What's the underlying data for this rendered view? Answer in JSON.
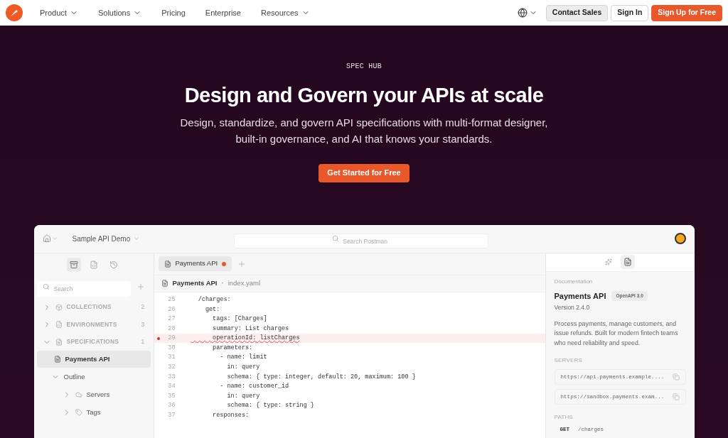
{
  "nav": {
    "items": [
      {
        "label": "Product",
        "dropdown": true
      },
      {
        "label": "Solutions",
        "dropdown": true
      },
      {
        "label": "Pricing",
        "dropdown": false
      },
      {
        "label": "Enterprise",
        "dropdown": false
      },
      {
        "label": "Resources",
        "dropdown": true
      }
    ],
    "buttons": [
      {
        "label": "Contact Sales",
        "kind": "secondary"
      },
      {
        "label": "Sign In",
        "kind": "outline"
      },
      {
        "label": "Sign Up for Free",
        "kind": "primary"
      }
    ]
  },
  "hero": {
    "eyebrow": "SPEC HUB",
    "title": "Design and Govern your APIs at scale",
    "subtitle": "Design, standardize, and govern API specifications with multi-format designer, built-in governance, and AI that knows your standards.",
    "cta": "Get Started for Free"
  },
  "app": {
    "workspace": "Sample API Demo",
    "search": {
      "placeholder": "Search Postman"
    },
    "sidebar": {
      "search": {
        "placeholder": "Search"
      },
      "sections": [
        {
          "label": "COLLECTIONS",
          "count": "2",
          "expanded": false
        },
        {
          "label": "ENVIRONMENTS",
          "count": "3",
          "expanded": false
        },
        {
          "label": "SPECIFICATIONS",
          "count": "1",
          "expanded": true
        }
      ],
      "items": [
        {
          "label": "Payments API",
          "selected": true,
          "children": [
            {
              "label": "Outline",
              "expanded": true,
              "children": [
                {
                  "label": "Servers",
                  "expanded": false
                },
                {
                  "label": "Tags",
                  "expanded": false
                }
              ]
            }
          ]
        }
      ]
    },
    "tabs": [
      {
        "label": "Payments API",
        "selected": true,
        "unsaved": true
      }
    ],
    "breadcrumb": {
      "title": "Payments API",
      "separator": "·",
      "file": "index.yaml"
    },
    "code": [
      {
        "line": "25",
        "text": "  /charges:",
        "error": false
      },
      {
        "line": "26",
        "text": "    get:",
        "error": false
      },
      {
        "line": "27",
        "text": "      tags: [Charges]",
        "error": false
      },
      {
        "line": "28",
        "text": "      summary: List charges",
        "error": false
      },
      {
        "line": "29",
        "text": "      operationId: listCharges",
        "error": true
      },
      {
        "line": "30",
        "text": "      parameters:",
        "error": false
      },
      {
        "line": "31",
        "text": "        - name: limit",
        "error": false
      },
      {
        "line": "32",
        "text": "          in: query",
        "error": false
      },
      {
        "line": "33",
        "text": "          schema: { type: integer, default: 20, maximum: 100 }",
        "error": false
      },
      {
        "line": "34",
        "text": "        - name: customer_id",
        "error": false
      },
      {
        "line": "35",
        "text": "          in: query",
        "error": false
      },
      {
        "line": "36",
        "text": "          schema: { type: string }",
        "error": false
      },
      {
        "line": "37",
        "text": "      responses:",
        "error": false
      }
    ],
    "docs": {
      "label": "Documentation",
      "title": "Payments API",
      "badge": "OpenAPI 3.0",
      "version": "Version 2.4.0",
      "description": "Process payments, manage customers, and issue refunds. Built for modern fintech teams who need reliability and speed.",
      "servers_label": "SERVERS",
      "servers": [
        "https://api.payments.example....",
        "https://sandbox.payments.exam..."
      ],
      "paths_label": "PATHS",
      "paths": [
        {
          "method": "GET",
          "path": "/charges"
        }
      ]
    }
  }
}
